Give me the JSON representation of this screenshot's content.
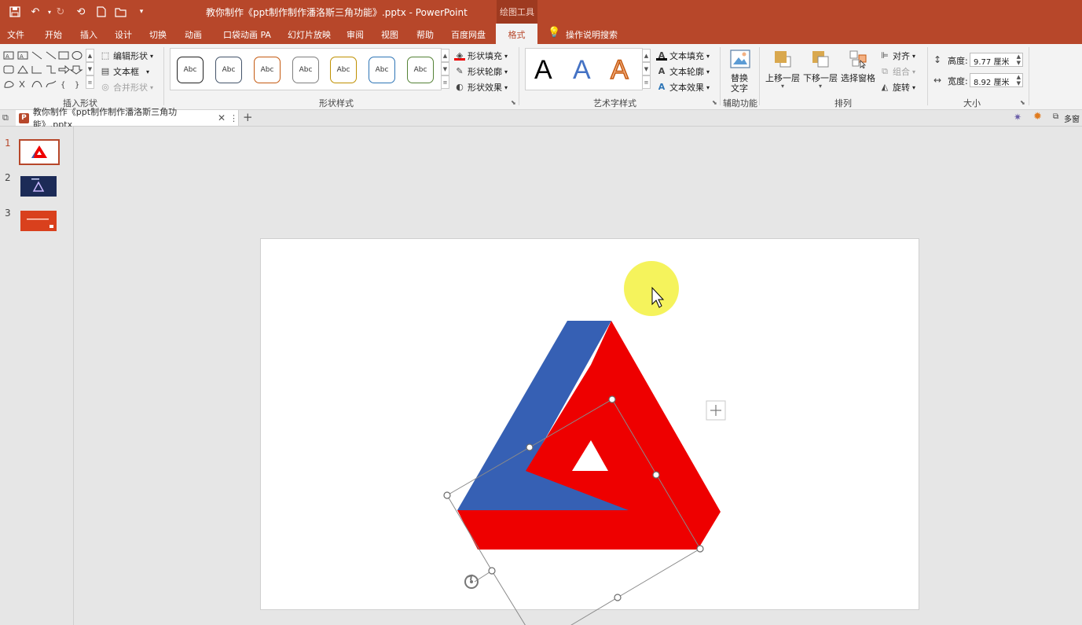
{
  "window": {
    "title": "教你制作《ppt制作制作潘洛斯三角功能》.pptx  -  PowerPoint",
    "context_group": "绘图工具",
    "quick_access": [
      "save-icon",
      "undo-icon",
      "redo-icon",
      "repeat-icon",
      "new-icon",
      "open-icon",
      "customize-icon"
    ]
  },
  "tabs": [
    "文件",
    "开始",
    "插入",
    "设计",
    "切换",
    "动画",
    "口袋动画 PA",
    "幻灯片放映",
    "审阅",
    "视图",
    "帮助",
    "百度网盘",
    "格式"
  ],
  "tell_me": "操作说明搜索",
  "ribbon": {
    "insert_shapes": {
      "label": "插入形状",
      "edit_shape": "编辑形状",
      "text_box": "文本框",
      "merge_shapes": "合并形状"
    },
    "shape_styles": {
      "label": "形状样式",
      "style_text": "Abc",
      "style_colors": [
        "#222222",
        "#44546a",
        "#c55a11",
        "#7f7f7f",
        "#bf9000",
        "#2e75b6",
        "#548235"
      ],
      "fill": "形状填充",
      "outline": "形状轮廓",
      "effects": "形状效果"
    },
    "wordart": {
      "label": "艺术字样式",
      "letter": "A",
      "text_fill": "文本填充",
      "text_outline": "文本轮廓",
      "text_effects": "文本效果"
    },
    "accessibility": {
      "label": "辅助功能",
      "alt_text_1": "替换",
      "alt_text_2": "文字"
    },
    "arrange": {
      "label": "排列",
      "bring_forward": "上移一层",
      "send_backward": "下移一层",
      "selection_pane": "选择窗格",
      "align": "对齐",
      "group": "组合",
      "rotate": "旋转"
    },
    "size": {
      "label": "大小",
      "height_label": "高度:",
      "height_value": "9.77 厘米",
      "width_label": "宽度:",
      "width_value": "8.92 厘米"
    }
  },
  "document_tab": {
    "name": "教你制作《ppt制作制作潘洛斯三角功能》.pptx",
    "multi_window": "多窗"
  },
  "slides": [
    {
      "number": "1",
      "selected": true
    },
    {
      "number": "2",
      "selected": false
    },
    {
      "number": "3",
      "selected": false
    }
  ],
  "canvas": {
    "triangle_colors": {
      "blue": "#3660b4",
      "red": "#ee0000"
    },
    "highlight_color": "#f4f24a"
  }
}
